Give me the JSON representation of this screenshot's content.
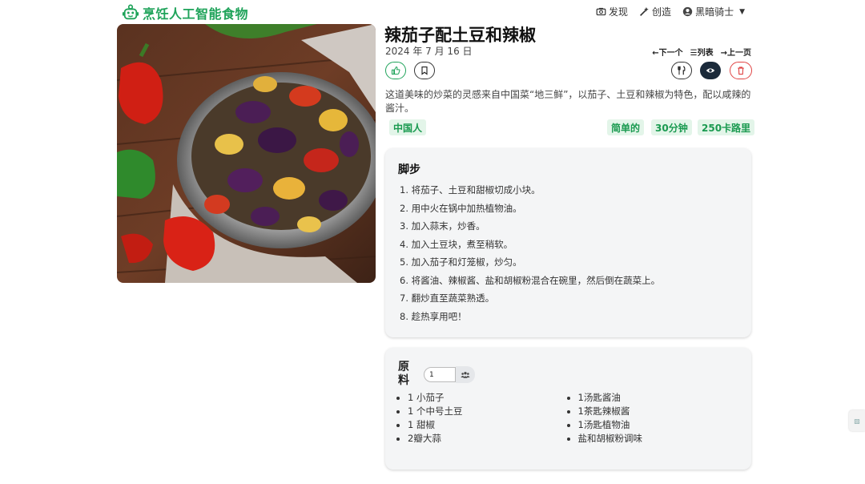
{
  "nav": {
    "brand": "烹饪人工智能食物",
    "discover": "发现",
    "create": "创造",
    "user": "黑暗骑士"
  },
  "recipe": {
    "title": "辣茄子配土豆和辣椒",
    "date": "2024 年 7 月 16 日",
    "description": "这道美味的炒菜的灵感来自中国菜“地三鲜”，以茄子、土豆和辣椒为特色，配以咸辣的酱汁。",
    "cuisine": "中国人",
    "difficulty": "简单的",
    "time": "30分钟",
    "calories": "250卡路里"
  },
  "pager": {
    "next": "←下一个",
    "list": "列表",
    "prev": "→上一页"
  },
  "steps": {
    "heading": "脚步",
    "items": [
      "1. 将茄子、土豆和甜椒切成小块。",
      "2. 用中火在锅中加热植物油。",
      "3. 加入蒜末，炒香。",
      "4. 加入土豆块，煮至稍软。",
      "5. 加入茄子和灯笼椒，炒匀。",
      "6. 将酱油、辣椒酱、盐和胡椒粉混合在碗里，然后倒在蔬菜上。",
      "7. 翻炒直至蔬菜熟透。",
      "8. 趁热享用吧！"
    ]
  },
  "ingredients": {
    "heading": "原料",
    "servings": "1",
    "left": [
      "1 小茄子",
      "1 个中号土豆",
      "1 甜椒",
      "2瓣大蒜"
    ],
    "right": [
      "1汤匙酱油",
      "1茶匙辣椒酱",
      "1汤匙植物油",
      "盐和胡椒粉调味"
    ]
  },
  "colors": {
    "brand": "#1fa35a",
    "tag_bg": "#e3f5e9",
    "danger": "#e04444",
    "dark_button": "#1b2a3a"
  },
  "icons": [
    "robot-chef-icon",
    "camera-icon",
    "magic-wand-icon",
    "user-circle-icon",
    "thumbs-up-icon",
    "bookmark-icon",
    "utensils-icon",
    "eye-icon",
    "trash-icon",
    "users-icon"
  ]
}
